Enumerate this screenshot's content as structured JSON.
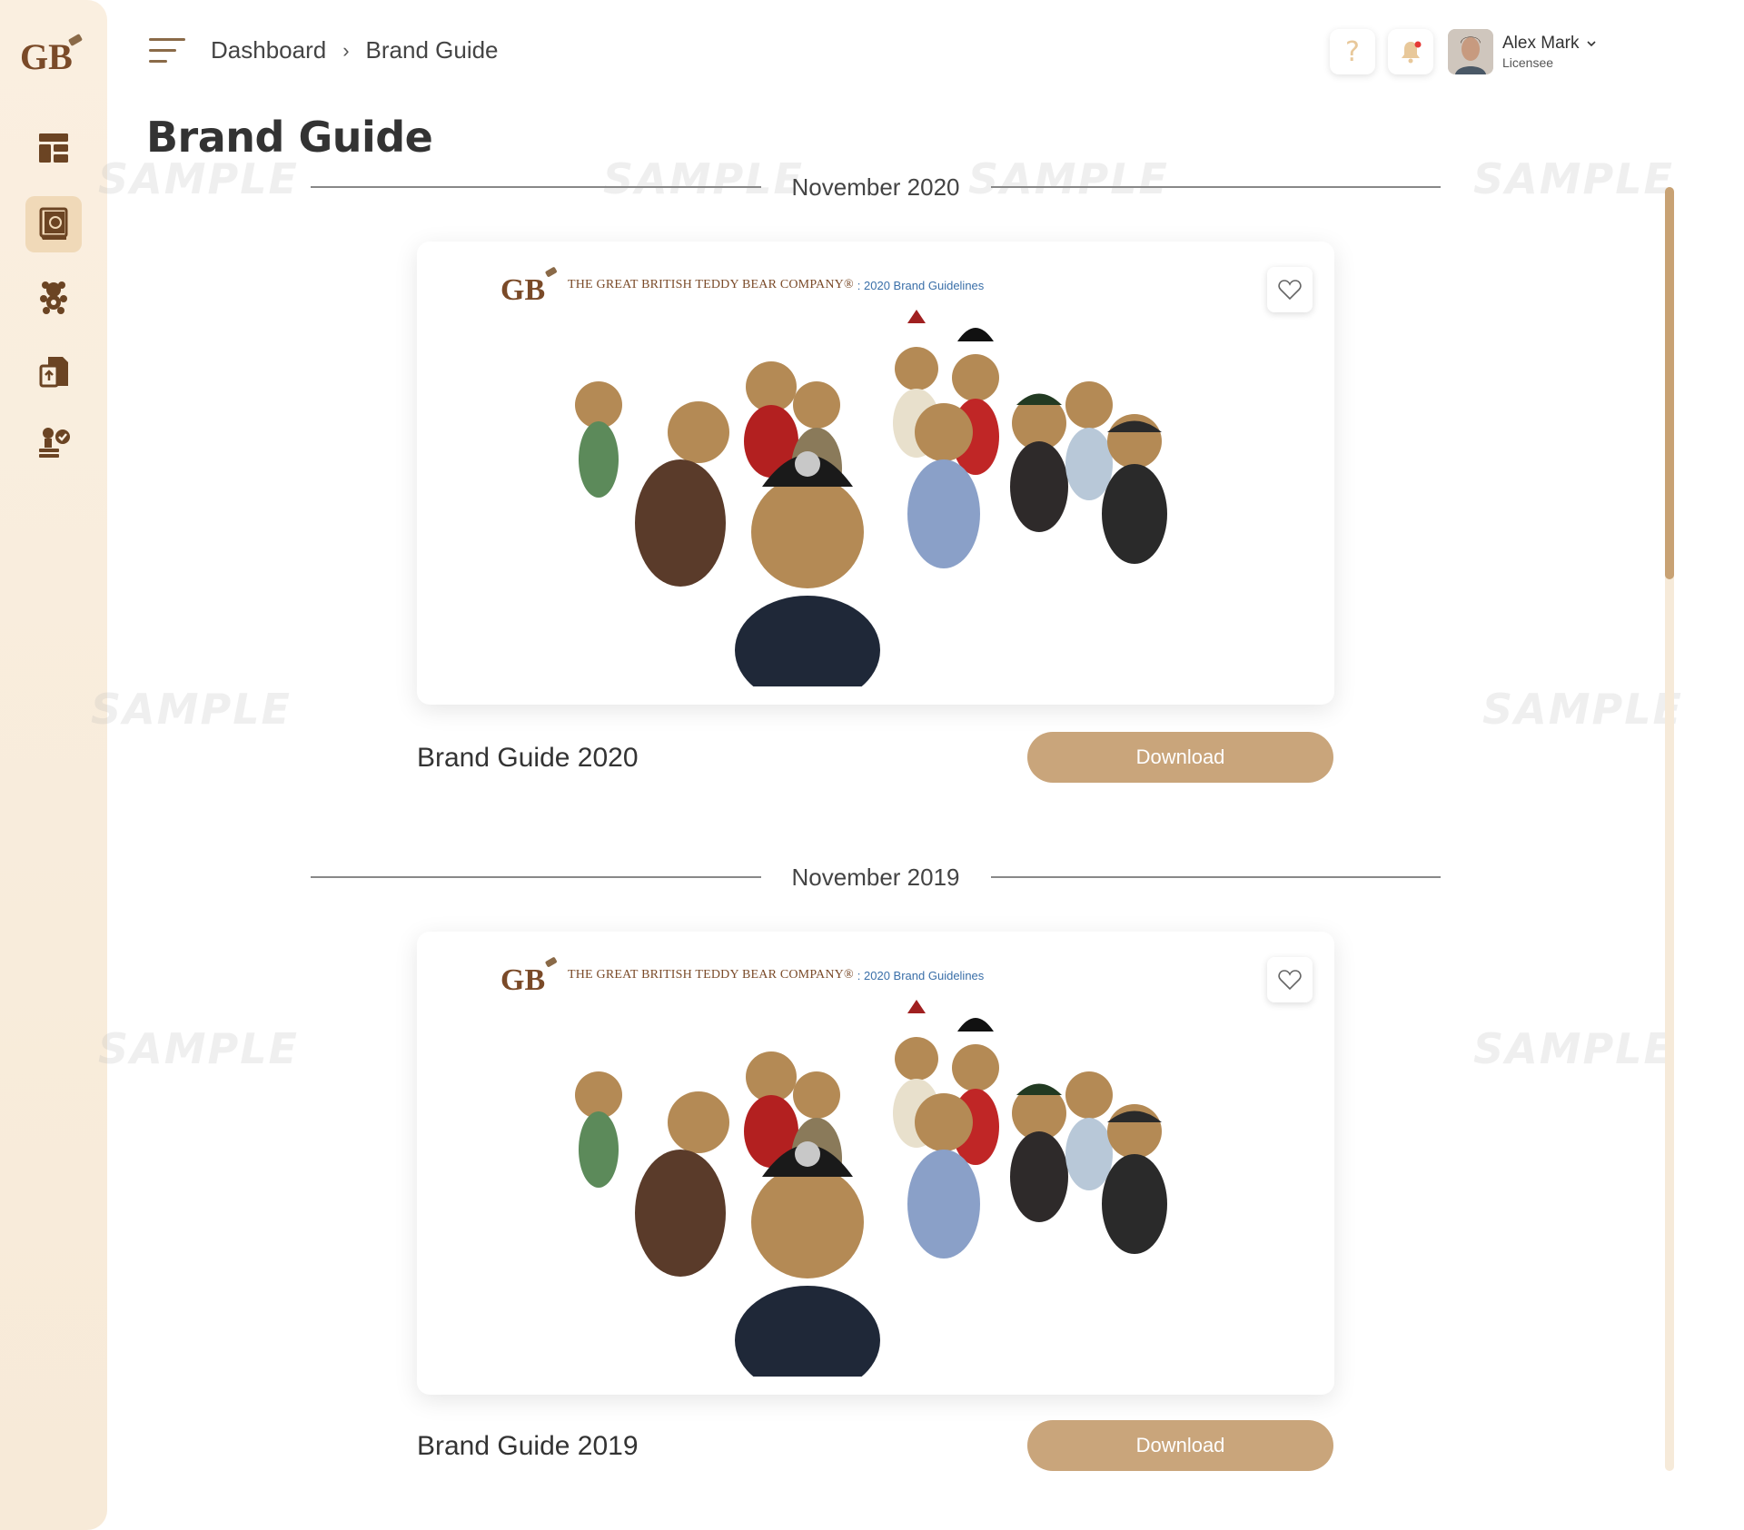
{
  "header": {
    "breadcrumb": [
      "Dashboard",
      "Brand Guide"
    ],
    "breadcrumb_sep": "›"
  },
  "user": {
    "name": "Alex Mark",
    "role": "Licensee"
  },
  "page": {
    "title": "Brand Guide"
  },
  "sidebar": {
    "items": [
      {
        "name": "dashboard",
        "icon": "layout-icon"
      },
      {
        "name": "brand-guide",
        "icon": "book-icon",
        "active": true
      },
      {
        "name": "products",
        "icon": "teddy-bear-icon"
      },
      {
        "name": "files",
        "icon": "file-upload-icon"
      },
      {
        "name": "approvals",
        "icon": "person-check-icon"
      }
    ]
  },
  "sections": [
    {
      "date": "November 2020",
      "guide_title": "Brand Guide 2020",
      "card_company": "THE GREAT BRITISH TEDDY BEAR COMPANY®",
      "card_subtitle": ": 2020 Brand Guidelines",
      "download_label": "Download"
    },
    {
      "date": "November 2019",
      "guide_title": "Brand Guide 2019",
      "card_company": "THE GREAT BRITISH TEDDY BEAR COMPANY®",
      "card_subtitle": ": 2020 Brand Guidelines",
      "download_label": "Download"
    }
  ],
  "watermark": "SAMPLE",
  "colors": {
    "accent": "#c9a57b",
    "sidebar_bg": "#faefe0",
    "sidebar_active": "#f0d9b8",
    "icon": "#6b4423"
  }
}
